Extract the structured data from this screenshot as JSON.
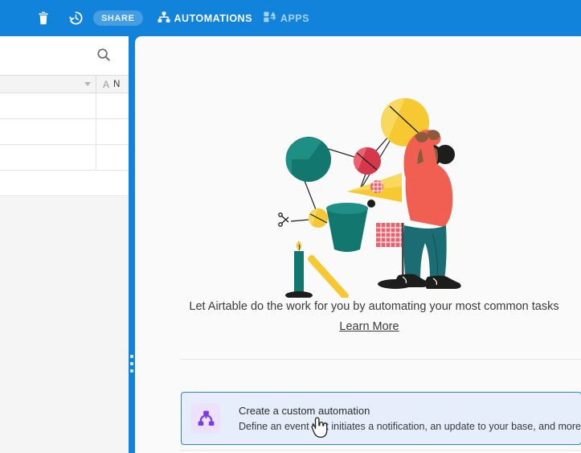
{
  "topbar": {
    "background": "#1283da",
    "trash_icon": "trash-icon",
    "history_icon": "history-clock-icon",
    "share_label": "SHARE",
    "automations_label": "AUTOMATIONS",
    "automations_icon": "hierarchy-icon",
    "apps_label": "APPS",
    "apps_icon": "blocks-icon"
  },
  "grid": {
    "search_icon": "search-icon",
    "header": {
      "sort_caret_icon": "chevron-down-icon",
      "field_type_icon": "text-field-a-icon",
      "field_name": "N"
    },
    "rows": [
      {
        "id": "row-1"
      },
      {
        "id": "row-2"
      },
      {
        "id": "row-3"
      },
      {
        "id": "row-4"
      }
    ]
  },
  "divider": {
    "handle_icon": "drag-handle-dots-icon"
  },
  "panel": {
    "illustration_name": "rube-goldberg-automation-illustration",
    "tagline": "Let Airtable do the work for you by automating your most common tasks",
    "learn_more_label": "Learn More",
    "cards": [
      {
        "icon": "automation-hierarchy-icon",
        "icon_color": "#7c3aed",
        "icon_background": "#ece2fb",
        "title": "Create a custom automation",
        "subtitle": "Define an event that initiates a notification, an update to your base, and more."
      }
    ],
    "cursor_icon": "pointer-hand-cursor"
  },
  "colors": {
    "brand_blue": "#1283da",
    "panel_background": "#fafafa",
    "card_border": "#2f80e0",
    "card_background": "#e6edfb",
    "accent_purple": "#7c3aed"
  }
}
